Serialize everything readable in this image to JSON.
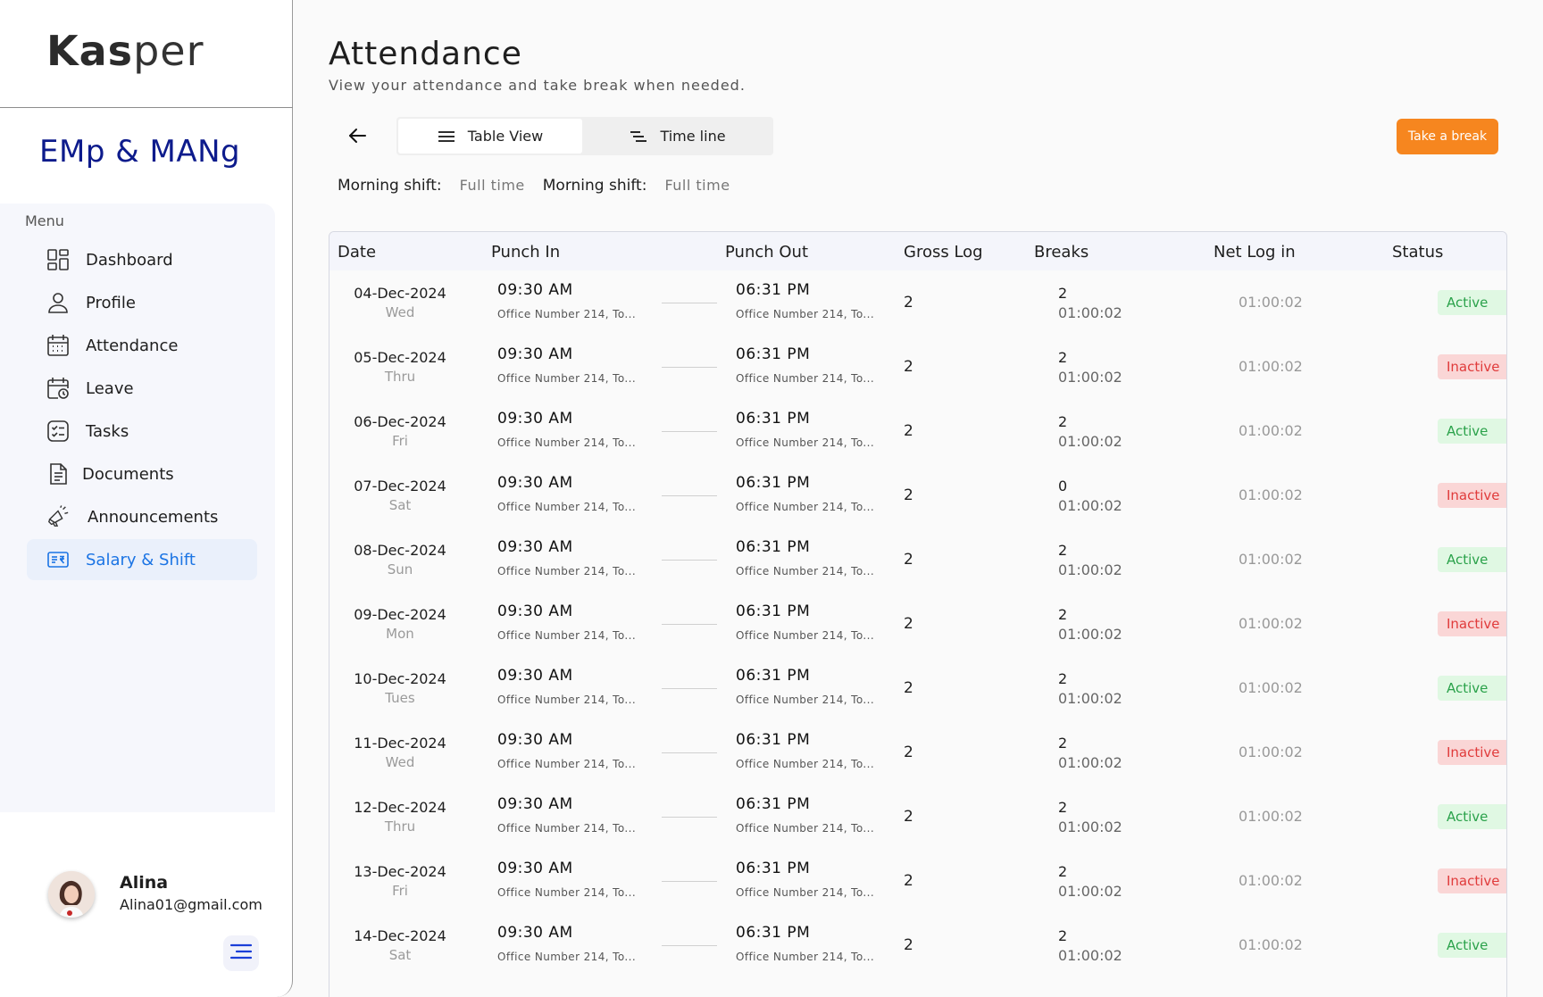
{
  "app": {
    "logo_bold": "Kas",
    "logo_rest": "per",
    "brand": "EMp & MANg"
  },
  "sidebar": {
    "menu_title": "Menu",
    "items": [
      {
        "label": "Dashboard",
        "icon": "dashboard-icon"
      },
      {
        "label": "Profile",
        "icon": "user-icon"
      },
      {
        "label": "Attendance",
        "icon": "calendar-icon"
      },
      {
        "label": "Leave",
        "icon": "calendar-clock-icon"
      },
      {
        "label": "Tasks",
        "icon": "checklist-icon"
      },
      {
        "label": "Documents",
        "icon": "document-icon"
      },
      {
        "label": "Announcements",
        "icon": "megaphone-icon"
      },
      {
        "label": "Salary & Shift",
        "icon": "salary-icon",
        "active": true
      }
    ]
  },
  "user": {
    "name": "Alina",
    "email": "Alina01@gmail.com"
  },
  "header": {
    "title": "Attendance",
    "subtitle": "View your attendance and take break when needed."
  },
  "toolbar": {
    "table_view": "Table View",
    "timeline": "Time line",
    "take_break": "Take a break"
  },
  "shift": {
    "label1": "Morning shift:",
    "value1": "Full time",
    "label2": "Morning shift:",
    "value2": "Full time"
  },
  "table": {
    "headers": [
      "Date",
      "Punch In",
      "Punch Out",
      "Gross Log",
      "Breaks",
      "Net Log in",
      "Status"
    ],
    "rows": [
      {
        "date": "04-Dec-2024",
        "day": "Wed",
        "in": "09:30 AM",
        "in_loc": "Office Number 214, To...",
        "out": "06:31 PM",
        "out_loc": "Office Number 214, To...",
        "gross": "2",
        "breaks": "2",
        "break_time": "01:00:02",
        "net": "01:00:02",
        "status": "Active"
      },
      {
        "date": "05-Dec-2024",
        "day": "Thru",
        "in": "09:30 AM",
        "in_loc": "Office Number 214, To...",
        "out": "06:31 PM",
        "out_loc": "Office Number 214, To...",
        "gross": "2",
        "breaks": "2",
        "break_time": "01:00:02",
        "net": "01:00:02",
        "status": "Inactive"
      },
      {
        "date": "06-Dec-2024",
        "day": "Fri",
        "in": "09:30 AM",
        "in_loc": "Office Number 214, To...",
        "out": "06:31 PM",
        "out_loc": "Office Number 214, To...",
        "gross": "2",
        "breaks": "2",
        "break_time": "01:00:02",
        "net": "01:00:02",
        "status": "Active"
      },
      {
        "date": "07-Dec-2024",
        "day": "Sat",
        "in": "09:30 AM",
        "in_loc": "Office Number 214, To...",
        "out": "06:31 PM",
        "out_loc": "Office Number 214, To...",
        "gross": "2",
        "breaks": "0",
        "break_time": "01:00:02",
        "net": "01:00:02",
        "status": "Inactive"
      },
      {
        "date": "08-Dec-2024",
        "day": "Sun",
        "in": "09:30 AM",
        "in_loc": "Office Number 214, To...",
        "out": "06:31 PM",
        "out_loc": "Office Number 214, To...",
        "gross": "2",
        "breaks": "2",
        "break_time": "01:00:02",
        "net": "01:00:02",
        "status": "Active"
      },
      {
        "date": "09-Dec-2024",
        "day": "Mon",
        "in": "09:30 AM",
        "in_loc": "Office Number 214, To...",
        "out": "06:31 PM",
        "out_loc": "Office Number 214, To...",
        "gross": "2",
        "breaks": "2",
        "break_time": "01:00:02",
        "net": "01:00:02",
        "status": "Inactive"
      },
      {
        "date": "10-Dec-2024",
        "day": "Tues",
        "in": "09:30 AM",
        "in_loc": "Office Number 214, To...",
        "out": "06:31 PM",
        "out_loc": "Office Number 214, To...",
        "gross": "2",
        "breaks": "2",
        "break_time": "01:00:02",
        "net": "01:00:02",
        "status": "Active"
      },
      {
        "date": "11-Dec-2024",
        "day": "Wed",
        "in": "09:30 AM",
        "in_loc": "Office Number 214, To...",
        "out": "06:31 PM",
        "out_loc": "Office Number 214, To...",
        "gross": "2",
        "breaks": "2",
        "break_time": "01:00:02",
        "net": "01:00:02",
        "status": "Inactive"
      },
      {
        "date": "12-Dec-2024",
        "day": "Thru",
        "in": "09:30 AM",
        "in_loc": "Office Number 214, To...",
        "out": "06:31 PM",
        "out_loc": "Office Number 214, To...",
        "gross": "2",
        "breaks": "2",
        "break_time": "01:00:02",
        "net": "01:00:02",
        "status": "Active"
      },
      {
        "date": "13-Dec-2024",
        "day": "Fri",
        "in": "09:30 AM",
        "in_loc": "Office Number 214, To...",
        "out": "06:31 PM",
        "out_loc": "Office Number 214, To...",
        "gross": "2",
        "breaks": "2",
        "break_time": "01:00:02",
        "net": "01:00:02",
        "status": "Inactive"
      },
      {
        "date": "14-Dec-2024",
        "day": "Sat",
        "in": "09:30 AM",
        "in_loc": "Office Number 214, To...",
        "out": "06:31 PM",
        "out_loc": "Office Number 214, To...",
        "gross": "2",
        "breaks": "2",
        "break_time": "01:00:02",
        "net": "01:00:02",
        "status": "Active"
      }
    ]
  }
}
